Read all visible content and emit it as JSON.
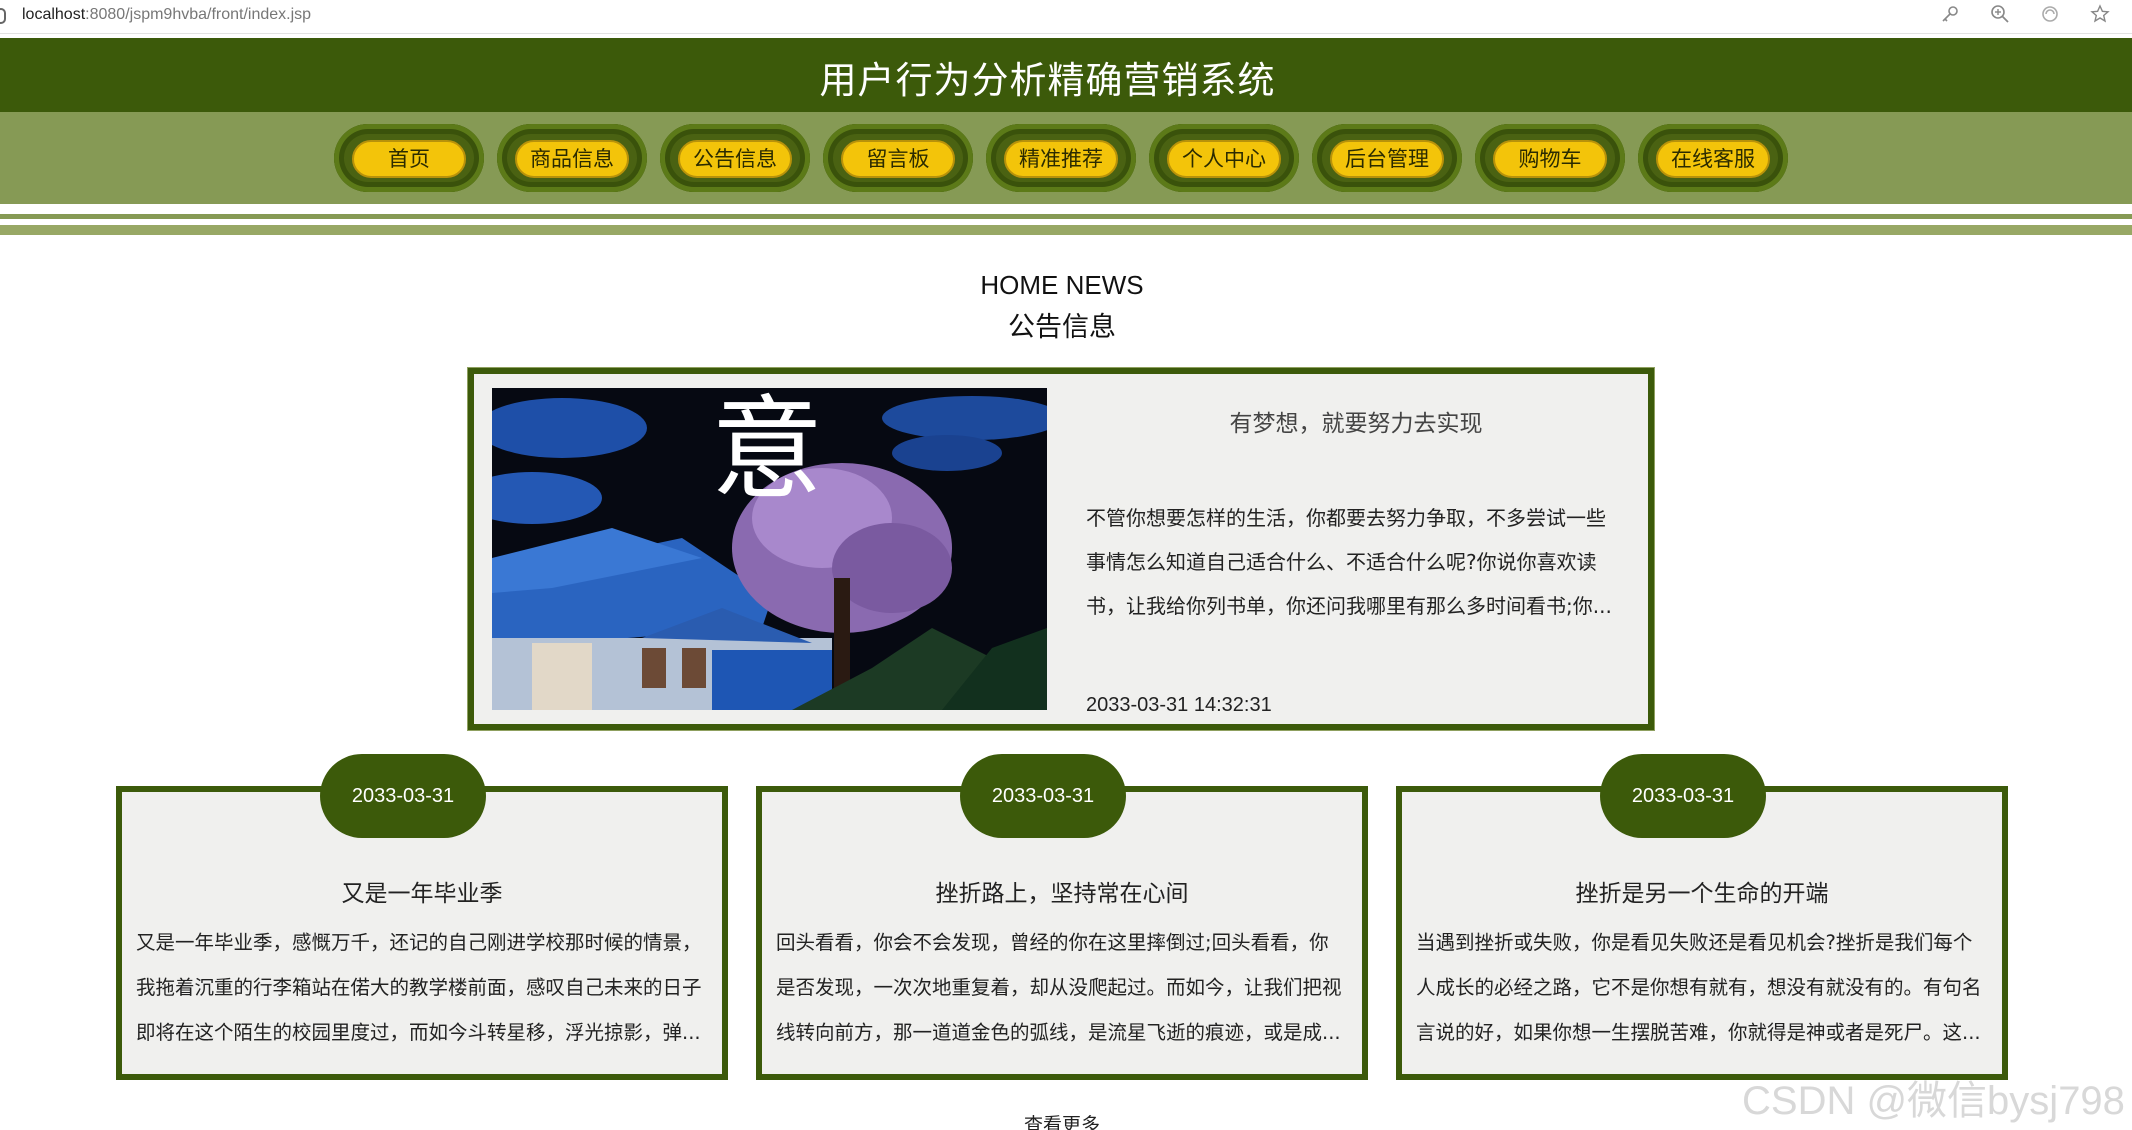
{
  "browser": {
    "url_host": "localhost",
    "url_rest": ":8080/jspm9hvba/front/index.jsp"
  },
  "header": {
    "title": "用户行为分析精确营销系统"
  },
  "nav": {
    "items": [
      {
        "label": "首页"
      },
      {
        "label": "商品信息"
      },
      {
        "label": "公告信息"
      },
      {
        "label": "留言板"
      },
      {
        "label": "精准推荐"
      },
      {
        "label": "个人中心"
      },
      {
        "label": "后台管理"
      },
      {
        "label": "购物车"
      },
      {
        "label": "在线客服"
      }
    ]
  },
  "section": {
    "title_en": "HOME NEWS",
    "title_cn": "公告信息"
  },
  "featured": {
    "image_text": "意",
    "title": "有梦想，就要努力去实现",
    "lines": [
      "不管你想要怎样的生活，你都要去努力争取，不多尝试一些",
      "事情怎么知道自己适合什么、不适合什么呢?你说你喜欢读",
      "书，让我给你列书单，你还问我哪里有那么多时间看书;你..."
    ],
    "date": "2033-03-31 14:32:31"
  },
  "cards": [
    {
      "date": "2033-03-31",
      "title": "又是一年毕业季",
      "lines": [
        "又是一年毕业季，感慨万千，还记的自己刚进学校那时候的情景，",
        "我拖着沉重的行李箱站在偌大的教学楼前面，感叹自己未来的日子",
        "即将在这个陌生的校园里度过，而如今斗转星移，浮光掠影，弹..."
      ]
    },
    {
      "date": "2033-03-31",
      "title": "挫折路上，坚持常在心间",
      "lines": [
        "回头看看，你会不会发现，曾经的你在这里摔倒过;回头看看，你",
        "是否发现，一次次地重复着，却从没爬起过。而如今，让我们把视",
        "线转向前方，那一道道金色的弧线，是流星飞逝的痕迹，或是成..."
      ]
    },
    {
      "date": "2033-03-31",
      "title": "挫折是另一个生命的开端",
      "lines": [
        "当遇到挫折或失败，你是看见失败还是看见机会?挫折是我们每个",
        "人成长的必经之路，它不是你想有就有，想没有就没有的。有句名",
        "言说的好，如果你想一生摆脱苦难，你就得是神或者是死尸。这..."
      ]
    }
  ],
  "more_label": "查看更多",
  "watermark": "CSDN @微信bysj798",
  "colors": {
    "header_bg": "#3c5a0a",
    "nav_bg": "#869a55",
    "pill_yellow": "#f3c40a",
    "card_bg": "#f0f0ee"
  }
}
